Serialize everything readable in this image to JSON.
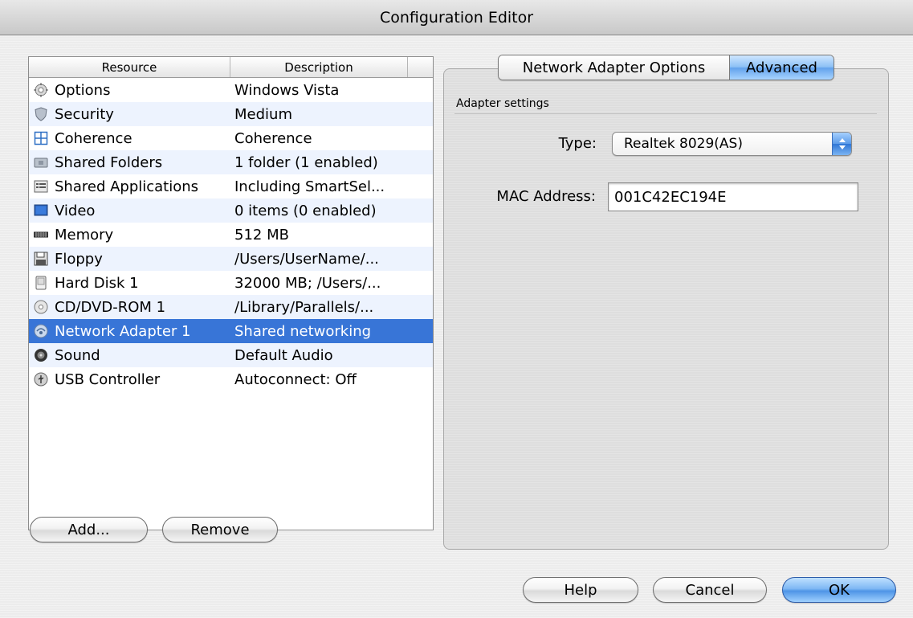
{
  "window": {
    "title": "Configuration Editor"
  },
  "resources_table": {
    "columns": [
      "Resource",
      "Description"
    ],
    "rows": [
      {
        "icon": "gear-icon",
        "resource": "Options",
        "description": "Windows Vista"
      },
      {
        "icon": "shield-icon",
        "resource": "Security",
        "description": "Medium"
      },
      {
        "icon": "coherence-icon",
        "resource": "Coherence",
        "description": "Coherence"
      },
      {
        "icon": "folder-icon",
        "resource": "Shared Folders",
        "description": "1 folder (1 enabled)"
      },
      {
        "icon": "applications-icon",
        "resource": "Shared Applications",
        "description": "Including SmartSel..."
      },
      {
        "icon": "monitor-icon",
        "resource": "Video",
        "description": "0 items (0 enabled)"
      },
      {
        "icon": "memory-chip-icon",
        "resource": "Memory",
        "description": "512 MB"
      },
      {
        "icon": "floppy-disk-icon",
        "resource": "Floppy",
        "description": "/Users/UserName/..."
      },
      {
        "icon": "hard-disk-icon",
        "resource": "Hard Disk 1",
        "description": "32000 MB; /Users/..."
      },
      {
        "icon": "cd-icon",
        "resource": "CD/DVD-ROM 1",
        "description": "/Library/Parallels/..."
      },
      {
        "icon": "network-icon",
        "resource": "Network Adapter 1",
        "description": "Shared networking",
        "selected": true
      },
      {
        "icon": "speaker-icon",
        "resource": "Sound",
        "description": "Default Audio"
      },
      {
        "icon": "usb-icon",
        "resource": "USB Controller",
        "description": "Autoconnect: Off"
      }
    ]
  },
  "list_buttons": {
    "add": "Add...",
    "remove": "Remove"
  },
  "tabs": [
    {
      "label": "Network Adapter Options",
      "active": false
    },
    {
      "label": "Advanced",
      "active": true
    }
  ],
  "adapter_settings": {
    "section_title": "Adapter settings",
    "type_label": "Type:",
    "type_value": "Realtek 8029(AS)",
    "mac_label": "MAC Address:",
    "mac_value": "001C42EC194E"
  },
  "dialog_buttons": {
    "help": "Help",
    "cancel": "Cancel",
    "ok": "OK"
  },
  "colors": {
    "selection": "#3875d7",
    "stripe": "#edf3fe",
    "accent_button": "#4e94e6"
  }
}
